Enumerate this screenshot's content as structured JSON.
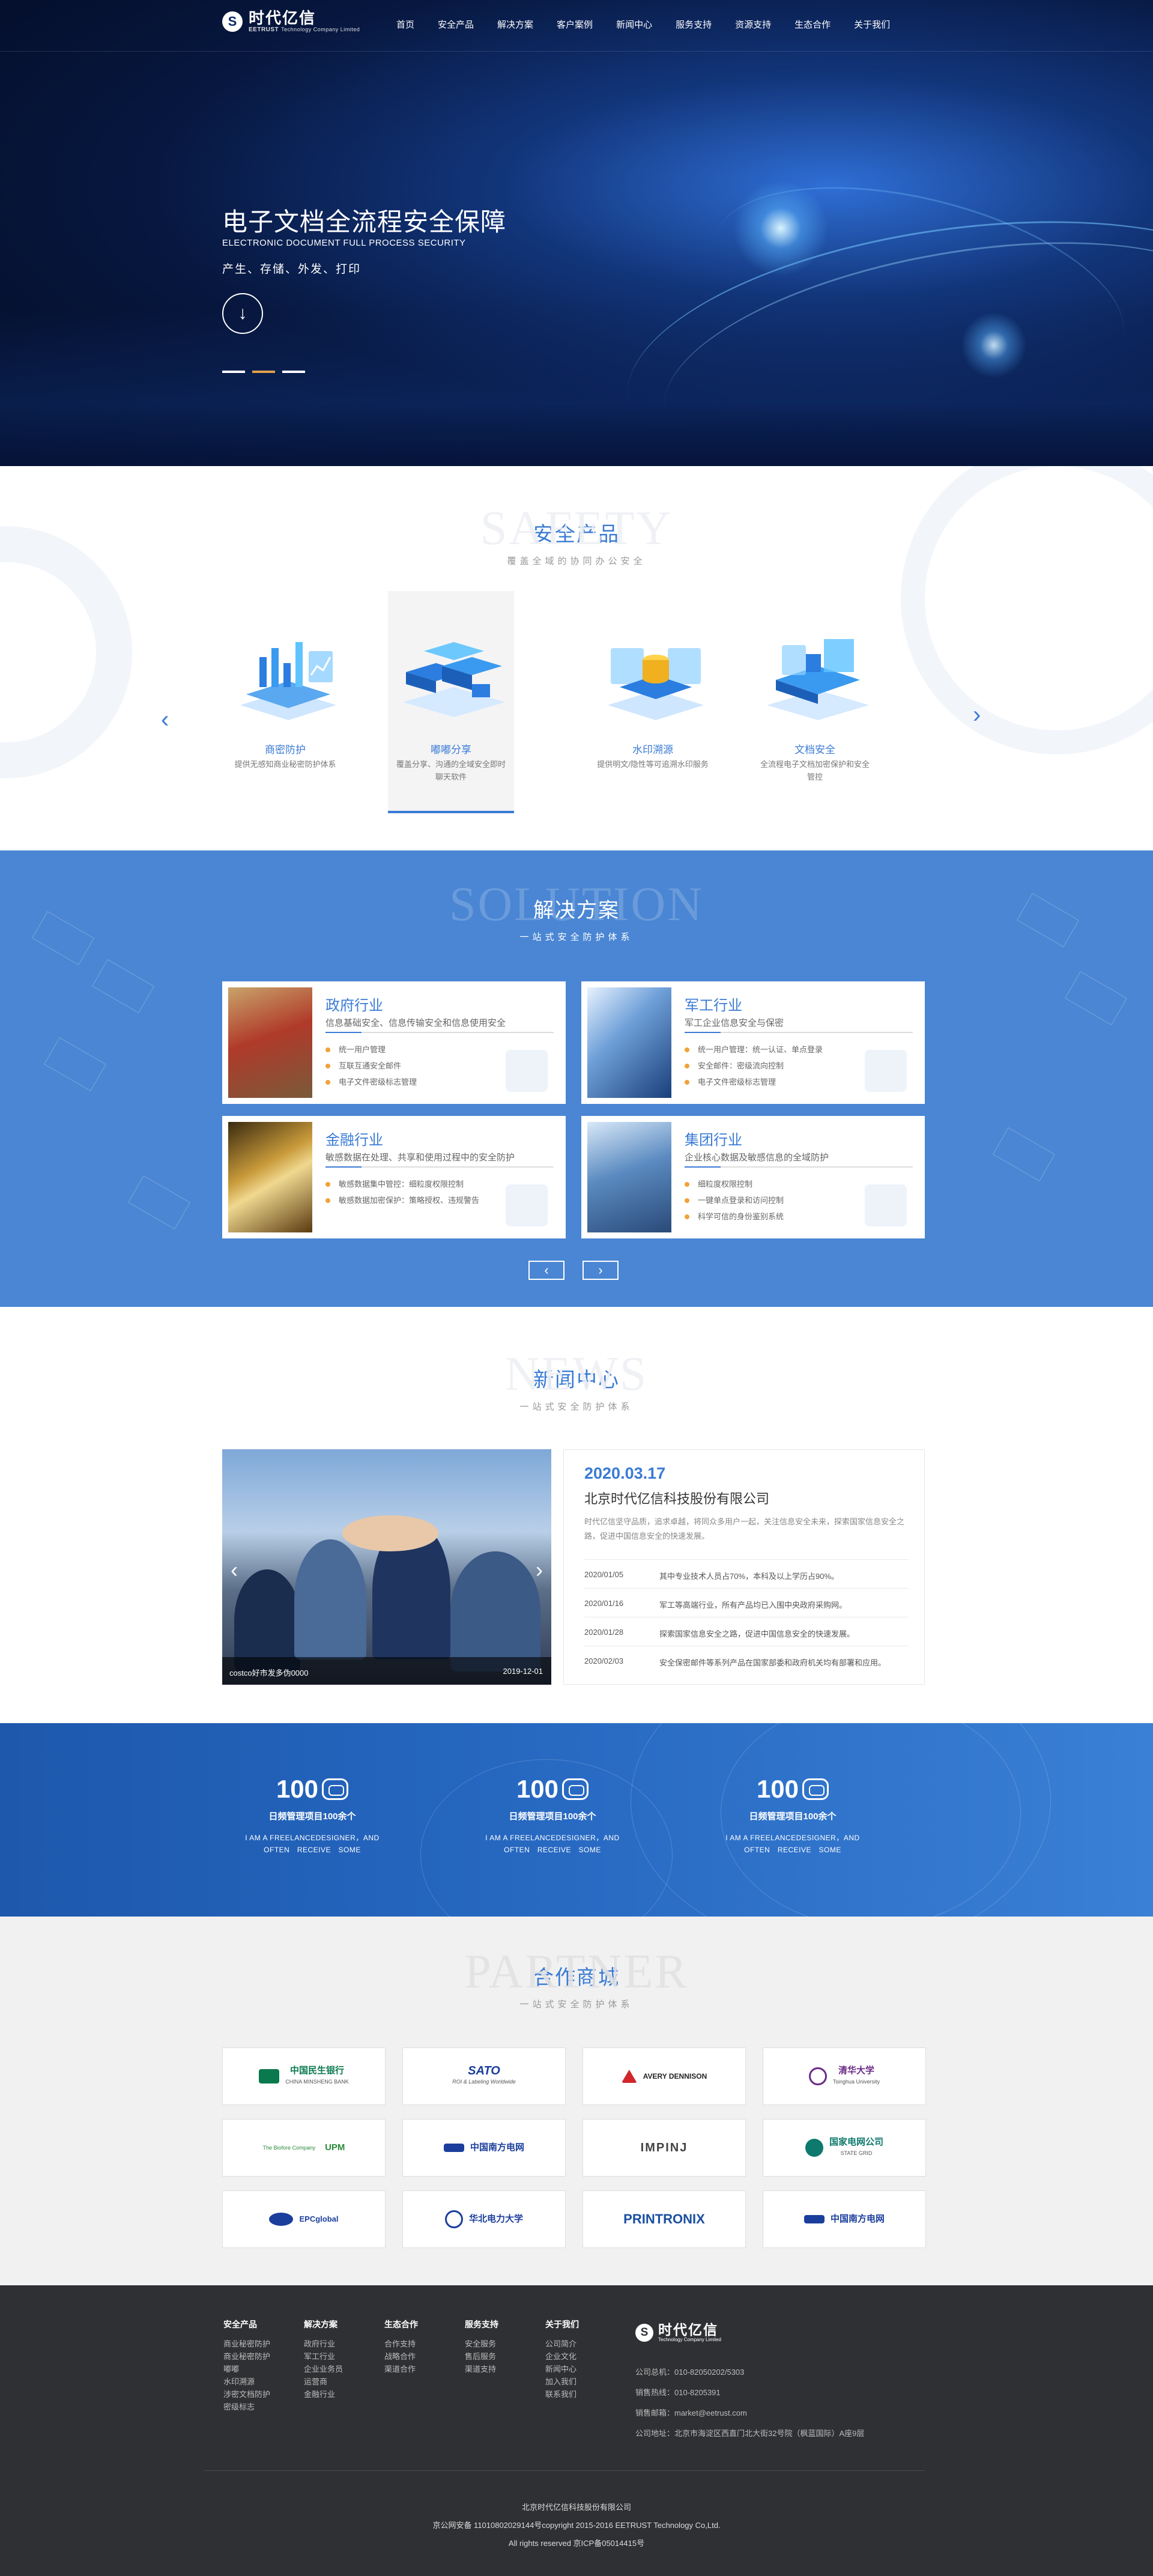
{
  "header": {
    "logo_cn": "时代亿信",
    "logo_brand": "EETRUST",
    "logo_en": "Technology Company Limited",
    "nav": [
      "首页",
      "安全产品",
      "解决方案",
      "客户案例",
      "新闻中心",
      "服务支持",
      "资源支持",
      "生态合作",
      "关于我们"
    ]
  },
  "hero": {
    "title": "电子文档全流程安全保障",
    "subtitle": "ELECTRONIC DOCUMENT FULL PROCESS SECURITY",
    "desc": "产生、存储、外发、打印",
    "button_icon": "arrow-down-icon"
  },
  "safety": {
    "ghost": "SAFETY",
    "title": "安全产品",
    "subtitle": "覆盖全域的协同办公安全",
    "products": [
      {
        "name": "商密防护",
        "desc": "提供无感知商业秘密防护体系",
        "icon": "chart-platform-icon"
      },
      {
        "name": "嘟嘟分享",
        "desc": "覆盖分享、沟通的全域安全即时聊天软件",
        "icon": "server-blocks-icon"
      },
      {
        "name": "水印溯源",
        "desc": "提供明文/隐性等可追溯水印服务",
        "icon": "database-screen-icon"
      },
      {
        "name": "文档安全",
        "desc": "全流程电子文档加密保护和安全管控",
        "icon": "document-blocks-icon"
      }
    ],
    "active_index": 1
  },
  "solution": {
    "ghost": "SOLUTION",
    "title": "解决方案",
    "subtitle": "一站式安全防护体系",
    "cards": [
      {
        "title": "政府行业",
        "sub": "信息基础安全、信息传输安全和信息使用安全",
        "items": [
          "统一用户管理",
          "互联互通安全邮件",
          "电子文件密级标志管理"
        ],
        "pic": "government-building-photo"
      },
      {
        "title": "军工行业",
        "sub": "军工企业信息安全与保密",
        "items": [
          "统一用户管理：统一认证、单点登录",
          "安全邮件：密级流向控制",
          "电子文件密级标志管理"
        ],
        "pic": "glass-building-photo"
      },
      {
        "title": "金融行业",
        "sub": "敏感数据在处理、共享和使用过程中的安全防护",
        "items": [
          "敏感数据集中管控：细粒度权限控制",
          "敏感数据加密保护：策略授权、违规警告"
        ],
        "pic": "gold-bars-photo"
      },
      {
        "title": "集团行业",
        "sub": "企业核心数据及敏感信息的全域防护",
        "items": [
          "细粒度权限控制",
          "一键单点登录和访问控制",
          "科学可信的身份鉴别系统"
        ],
        "pic": "skyscraper-photo"
      }
    ],
    "prev_label": "‹",
    "next_label": "›"
  },
  "news": {
    "ghost": "NEWS",
    "title": "新闻中心",
    "subtitle": "一站式安全防护体系",
    "photo_caption": "costco好市发多伪0000",
    "photo_date": "2019-12-01",
    "headline_date": "2020.03.17",
    "headline_company": "北京时代亿信科技股份有限公司",
    "intro": "时代亿信坚守品质，追求卓越，将同众多用户一起，关注信息安全未来，探索国家信息安全之路，促进中国信息安全的快速发展。",
    "items": [
      {
        "date": "2020/01/05",
        "text": "其中专业技术人员占70%，本科及以上学历占90%。"
      },
      {
        "date": "2020/01/16",
        "text": "军工等高端行业，所有产品均已入围中央政府采购网。"
      },
      {
        "date": "2020/01/28",
        "text": "探索国家信息安全之路，促进中国信息安全的快速发展。"
      },
      {
        "date": "2020/02/03",
        "text": "安全保密邮件等系列产品在国家部委和政府机关均有部署和应用。"
      }
    ]
  },
  "stats": [
    {
      "num": "100",
      "key": "日频管理项目100余个",
      "desc": "I AM A FREELANCEDESIGNER，AND OFTEN　RECEIVE　SOME"
    },
    {
      "num": "100",
      "key": "日频管理项目100余个",
      "desc": "I AM A FREELANCEDESIGNER，AND OFTEN　RECEIVE　SOME"
    },
    {
      "num": "100",
      "key": "日频管理项目100余个",
      "desc": "I AM A FREELANCEDESIGNER，AND OFTEN　RECEIVE　SOME"
    }
  ],
  "partner": {
    "ghost": "PARTNER",
    "title": "合作商城",
    "subtitle": "一站式安全防护体系",
    "logos": [
      {
        "main": "中国民生银行",
        "sub": "CHINA MINSHENG BANK",
        "color": "#0a7a4e"
      },
      {
        "main": "SATO",
        "sub": "ROI & Labeling Worldwide",
        "color": "#1b3e9c"
      },
      {
        "main": "AVERY DENNISON",
        "sub": "",
        "color": "#d0262c"
      },
      {
        "main": "清华大学",
        "sub": "Tsinghua University",
        "color": "#6a2a86"
      },
      {
        "main": "UPM",
        "sub": "The Biofore Company",
        "color": "#2a8a3a"
      },
      {
        "main": "中国南方电网",
        "sub": "",
        "color": "#1b3e9c"
      },
      {
        "main": "IMPINJ",
        "sub": "",
        "color": "#444444"
      },
      {
        "main": "国家电网公司",
        "sub": "STATE GRID",
        "color": "#0e7a6e"
      },
      {
        "main": "EPCglobal",
        "sub": "",
        "color": "#1b3e9c"
      },
      {
        "main": "华北电力大学",
        "sub": "",
        "color": "#1b3e9c"
      },
      {
        "main": "PRINTRONIX",
        "sub": "",
        "color": "#1b4fa0"
      },
      {
        "main": "中国南方电网",
        "sub": "",
        "color": "#1b3e9c"
      }
    ]
  },
  "footer": {
    "cols": [
      {
        "title": "安全产品",
        "links": [
          "商业秘密防护",
          "商业秘密防护",
          "嘟嘟",
          "水印溯源",
          "涉密文档防护",
          "密级标志"
        ]
      },
      {
        "title": "解决方案",
        "links": [
          "政府行业",
          "军工行业",
          "企业业务员",
          "运营商",
          "金融行业"
        ]
      },
      {
        "title": "生态合作",
        "links": [
          "合作支持",
          "战略合作",
          "渠道合作"
        ]
      },
      {
        "title": "服务支持",
        "links": [
          "安全服务",
          "售后服务",
          "渠道支持"
        ]
      },
      {
        "title": "关于我们",
        "links": [
          "公司简介",
          "企业文化",
          "新闻中心",
          "加入我们",
          "联系我们"
        ]
      }
    ],
    "logo_cn": "时代亿信",
    "logo_en": "Technology Company Limited",
    "info": [
      "公司总机：010-82050202/5303",
      "销售热线：010-8205391",
      "销售邮箱：market@eetrust.com",
      "公司地址：北京市海淀区西直门北大街32号院（枫蓝国际）A座9层"
    ],
    "bottom": [
      "北京时代亿信科技股份有限公司",
      "京公网安备 11010802029144号copyright 2015-2016 EETRUST Technology Co,Ltd.",
      "All rights reserved 京ICP备05014415号"
    ]
  }
}
